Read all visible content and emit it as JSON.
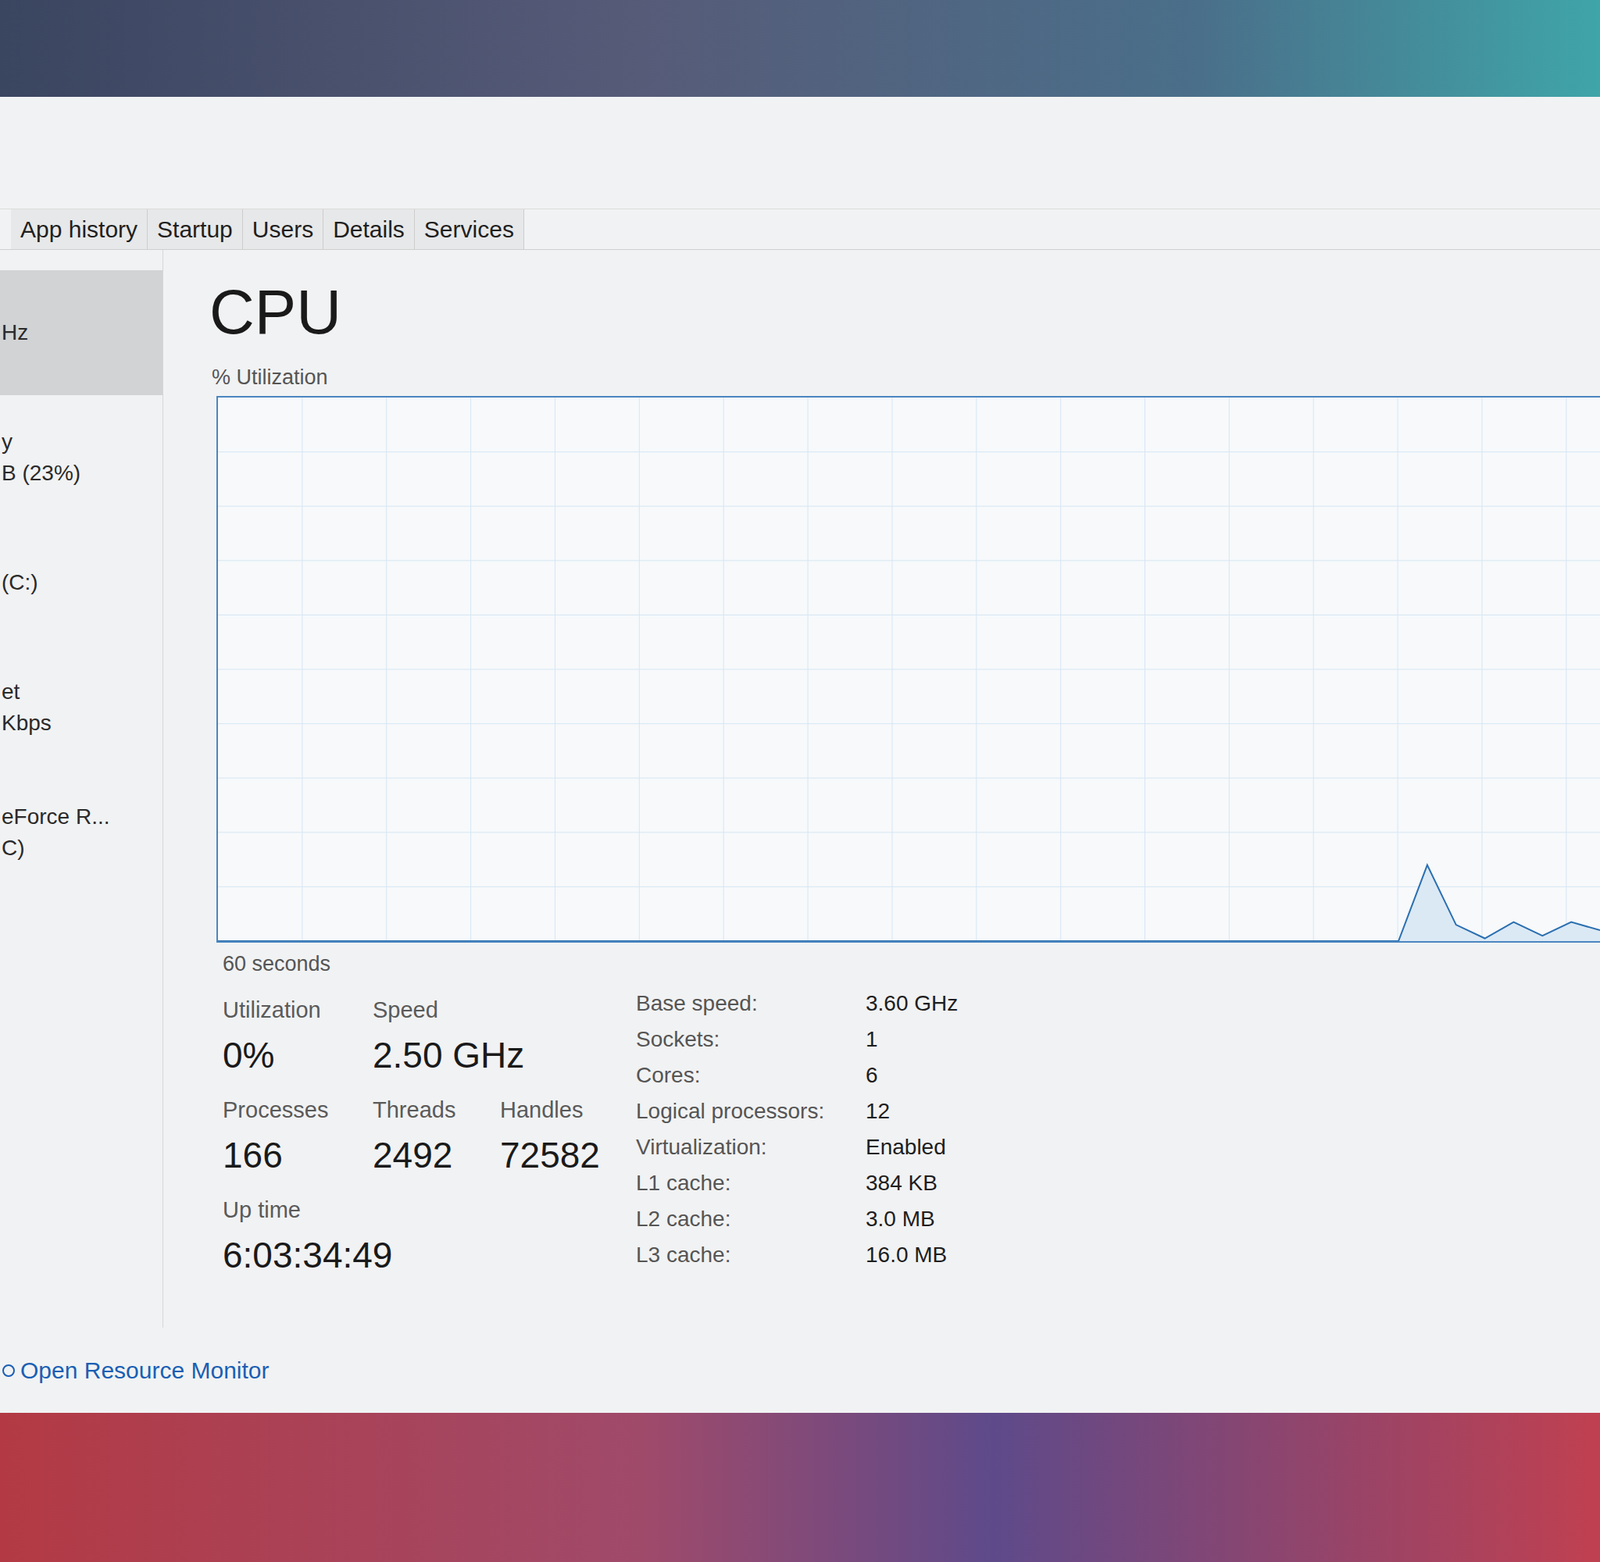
{
  "tabs": [
    {
      "label": "App history",
      "selected": false
    },
    {
      "label": "Startup",
      "selected": false
    },
    {
      "label": "Users",
      "selected": false
    },
    {
      "label": "Details",
      "selected": false
    },
    {
      "label": "Services",
      "selected": false
    }
  ],
  "sidebar": {
    "items": [
      {
        "lines": [
          "Hz"
        ],
        "selected": true
      },
      {
        "lines": [
          "y",
          "B (23%)"
        ],
        "selected": false
      },
      {
        "lines": [
          "(C:)"
        ],
        "selected": false
      },
      {
        "lines": [
          "et",
          "Kbps"
        ],
        "selected": false
      },
      {
        "lines": [
          "eForce R...",
          "C)"
        ],
        "selected": false
      }
    ]
  },
  "panel": {
    "title": "CPU",
    "chart": {
      "label": "% Utilization",
      "time_label": "60 seconds",
      "values": [
        0,
        0,
        0,
        0,
        0,
        0,
        0,
        0,
        0,
        0,
        0,
        0,
        0,
        0,
        0,
        0,
        0,
        0,
        0,
        0,
        0,
        0,
        0,
        0,
        0,
        0,
        0,
        0,
        0,
        0,
        0,
        0,
        0,
        0,
        0,
        0,
        0,
        0,
        0,
        0,
        0,
        0,
        14,
        3,
        0.5,
        3.5,
        1,
        3.5,
        2
      ]
    },
    "stats": [
      [
        {
          "label": "Utilization",
          "value": "0%"
        },
        {
          "label": "Speed",
          "value": "2.50 GHz"
        }
      ],
      [
        {
          "label": "Processes",
          "value": "166"
        },
        {
          "label": "Threads",
          "value": "2492"
        },
        {
          "label": "Handles",
          "value": "72582"
        }
      ],
      [
        {
          "label": "Up time",
          "value": "6:03:34:49"
        }
      ]
    ],
    "specs": [
      {
        "label": "Base speed:",
        "value": "3.60 GHz"
      },
      {
        "label": "Sockets:",
        "value": "1"
      },
      {
        "label": "Cores:",
        "value": "6"
      },
      {
        "label": "Logical processors:",
        "value": "12"
      },
      {
        "label": "Virtualization:",
        "value": "Enabled"
      },
      {
        "label": "L1 cache:",
        "value": "384 KB"
      },
      {
        "label": "L2 cache:",
        "value": "3.0 MB"
      },
      {
        "label": "L3 cache:",
        "value": "16.0 MB"
      }
    ]
  },
  "footer": {
    "link": "Open Resource Monitor"
  }
}
